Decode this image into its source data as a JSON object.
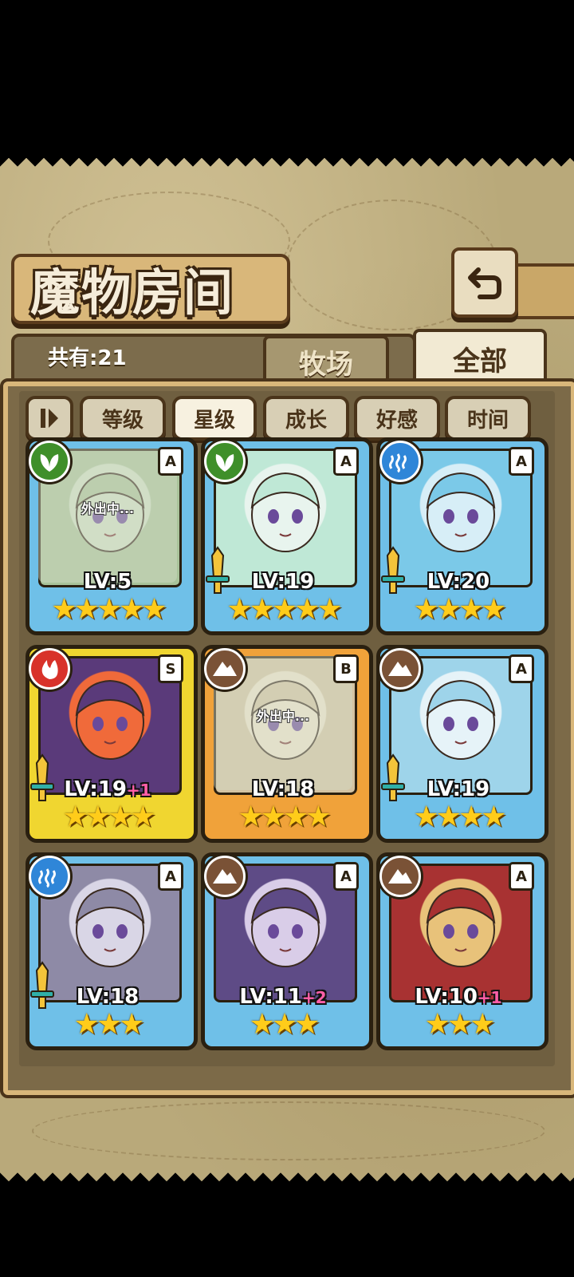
{
  "title": "魔物房间",
  "count_text": "共有:21",
  "tabs": [
    {
      "label": "牧场",
      "active": false
    },
    {
      "label": "全部",
      "active": true
    }
  ],
  "sort_toggle_icon": "sort-order-icon",
  "sort_buttons": [
    {
      "label": "等级",
      "selected": false
    },
    {
      "label": "星级",
      "selected": true
    },
    {
      "label": "成长",
      "selected": false
    },
    {
      "label": "好感",
      "selected": false
    },
    {
      "label": "时间",
      "selected": false
    }
  ],
  "away_label": "外出中...",
  "cards": [
    {
      "element": "leaf",
      "rank": "A",
      "level": "LV:5",
      "bonus": "",
      "stars": "★★★★★",
      "away": true,
      "sword": false
    },
    {
      "element": "leaf",
      "rank": "A",
      "level": "LV:19",
      "bonus": "",
      "stars": "★★★★★",
      "away": false,
      "sword": true
    },
    {
      "element": "water",
      "rank": "A",
      "level": "LV:20",
      "bonus": "",
      "stars": "★★★★",
      "away": false,
      "sword": true
    },
    {
      "element": "fire",
      "rank": "S",
      "level": "LV:19",
      "bonus": "+1",
      "stars": "★★★★",
      "away": false,
      "sword": true
    },
    {
      "element": "earth",
      "rank": "B",
      "level": "LV:18",
      "bonus": "",
      "stars": "★★★★",
      "away": true,
      "sword": false
    },
    {
      "element": "earth",
      "rank": "A",
      "level": "LV:19",
      "bonus": "",
      "stars": "★★★★",
      "away": false,
      "sword": true
    },
    {
      "element": "water",
      "rank": "A",
      "level": "LV:18",
      "bonus": "",
      "stars": "★★★",
      "away": false,
      "sword": true
    },
    {
      "element": "earth",
      "rank": "A",
      "level": "LV:11",
      "bonus": "+2",
      "stars": "★★★",
      "away": false,
      "sword": false
    },
    {
      "element": "earth",
      "rank": "A",
      "level": "LV:10",
      "bonus": "+1",
      "stars": "★★★",
      "away": false,
      "sword": false
    }
  ],
  "colors": {
    "leaf": "#3f8f2a",
    "water": "#2f86d8",
    "fire": "#d8322a",
    "earth": "#7a5236"
  }
}
